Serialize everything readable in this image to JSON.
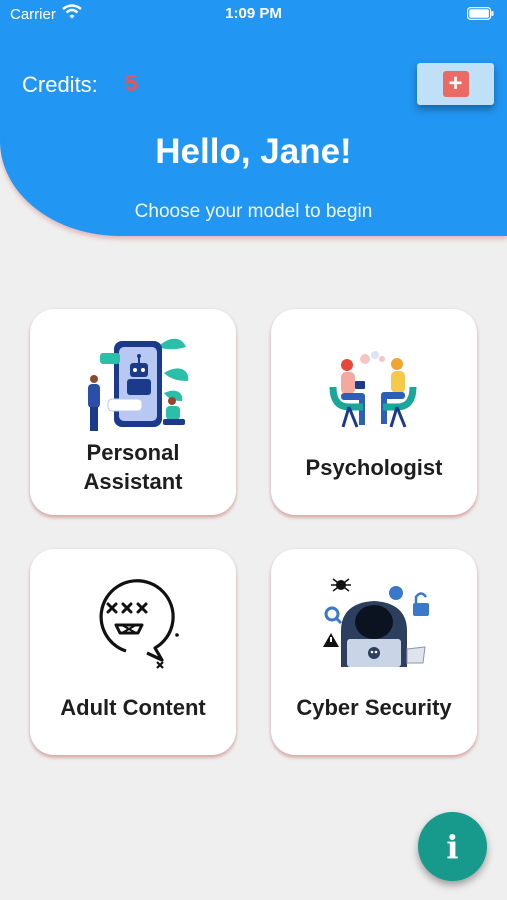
{
  "status_bar": {
    "carrier": "Carrier",
    "time": "1:09 PM"
  },
  "header": {
    "credits_label": "Credits:",
    "credits_value": "5",
    "add_credits_icon": "plus-icon",
    "greeting": "Hello, Jane!",
    "subtitle": "Choose your model to begin"
  },
  "models": [
    {
      "label_line1": "Personal",
      "label_line2": "Assistant",
      "icon": "robot-assistant-illustration"
    },
    {
      "label": "Psychologist",
      "icon": "therapy-session-illustration"
    },
    {
      "label": "Adult Content",
      "icon": "dizzy-face-illustration"
    },
    {
      "label": "Cyber Security",
      "icon": "hacker-illustration"
    }
  ],
  "info_button": {
    "glyph": "i"
  },
  "colors": {
    "header": "#2196f3",
    "credits": "#ef5350",
    "fab": "#179a8c",
    "background": "#efefef"
  }
}
